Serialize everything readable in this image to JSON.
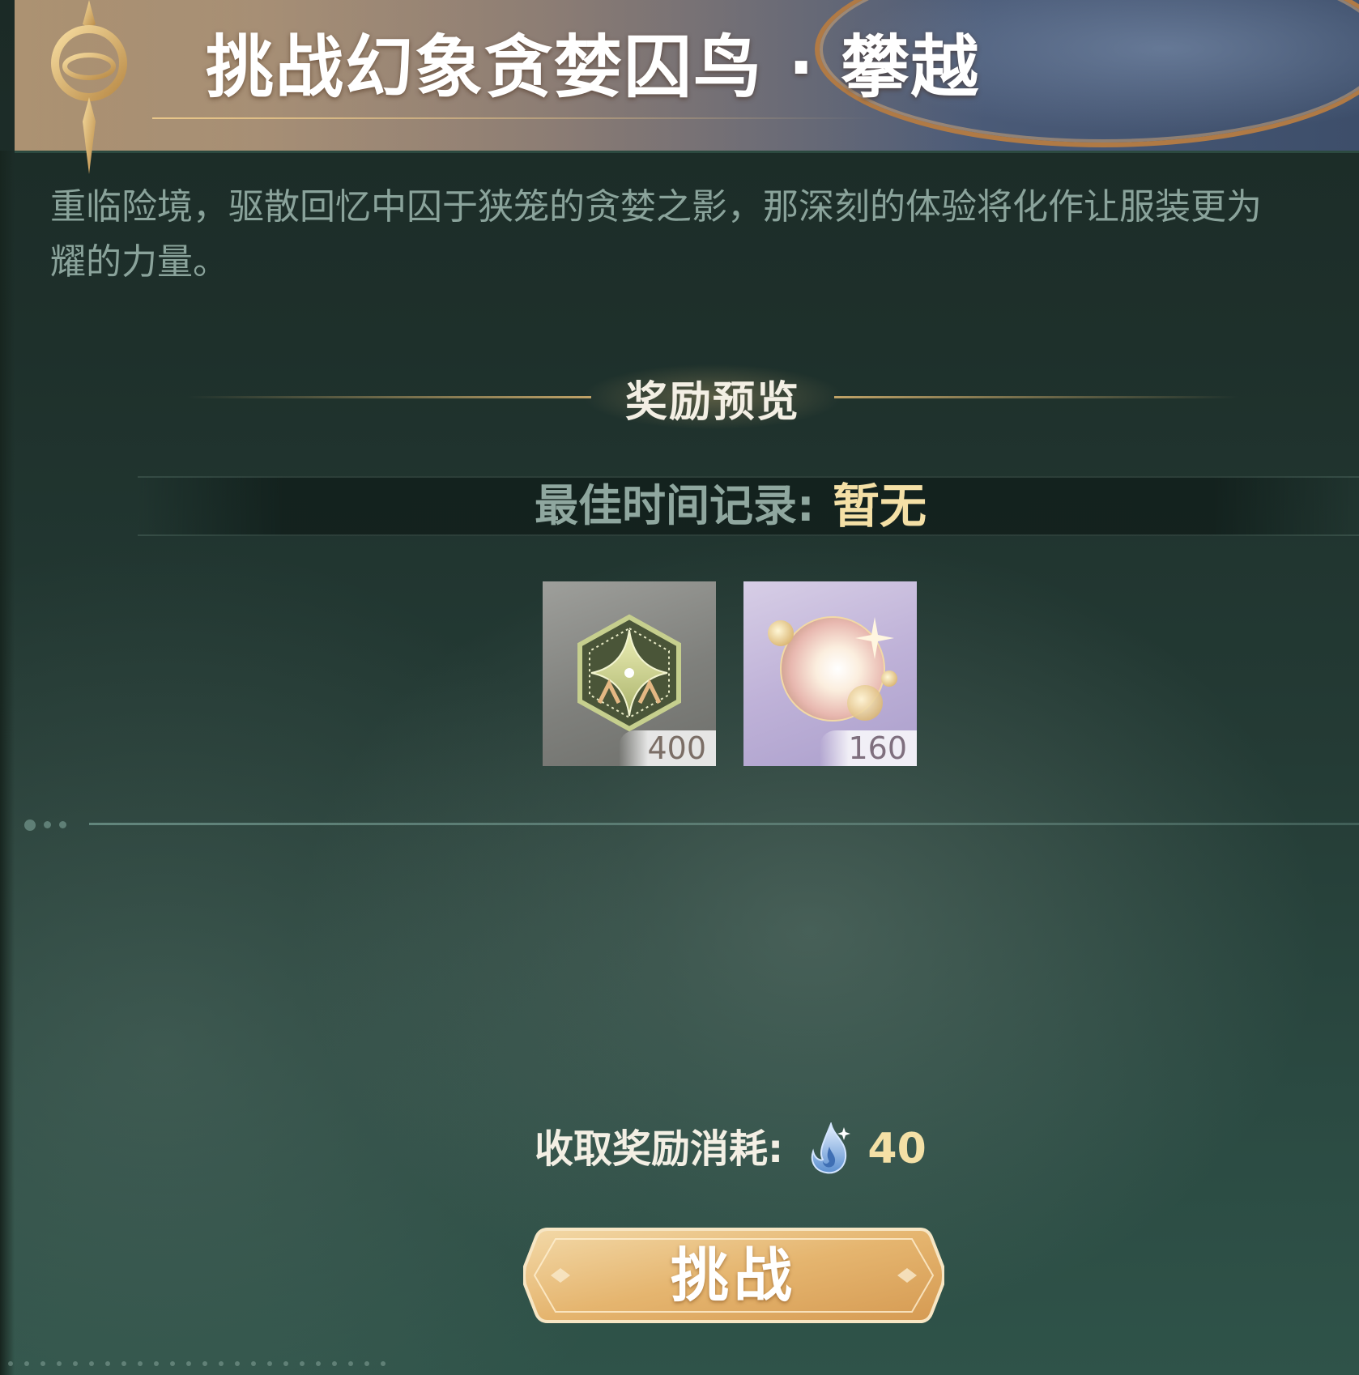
{
  "header": {
    "title": "挑战幻象贪婪囚鸟 · 攀越",
    "ornament_icon": "gold-eye-emblem-icon"
  },
  "description": {
    "line1": "重临险境，驱散回忆中囚于狭笼的贪婪之影，那深刻的体验将化作让服装更为",
    "line2": "耀的力量。"
  },
  "rewards_section": {
    "title": "奖励预览",
    "best_time_label": "最佳时间记录:",
    "best_time_value": "暂无",
    "items": [
      {
        "icon": "gold-star-badge-icon",
        "count": "400"
      },
      {
        "icon": "pearl-orb-icon",
        "count": "160"
      }
    ]
  },
  "cost": {
    "label": "收取奖励消耗:",
    "icon": "blue-flame-stamina-icon",
    "value": "40"
  },
  "actions": {
    "challenge_label": "挑战"
  },
  "colors": {
    "accent_gold": "#f4e0a6",
    "muted_text": "#8aa39b",
    "background": "#1f3a33",
    "button_gold": "#e6b574"
  }
}
